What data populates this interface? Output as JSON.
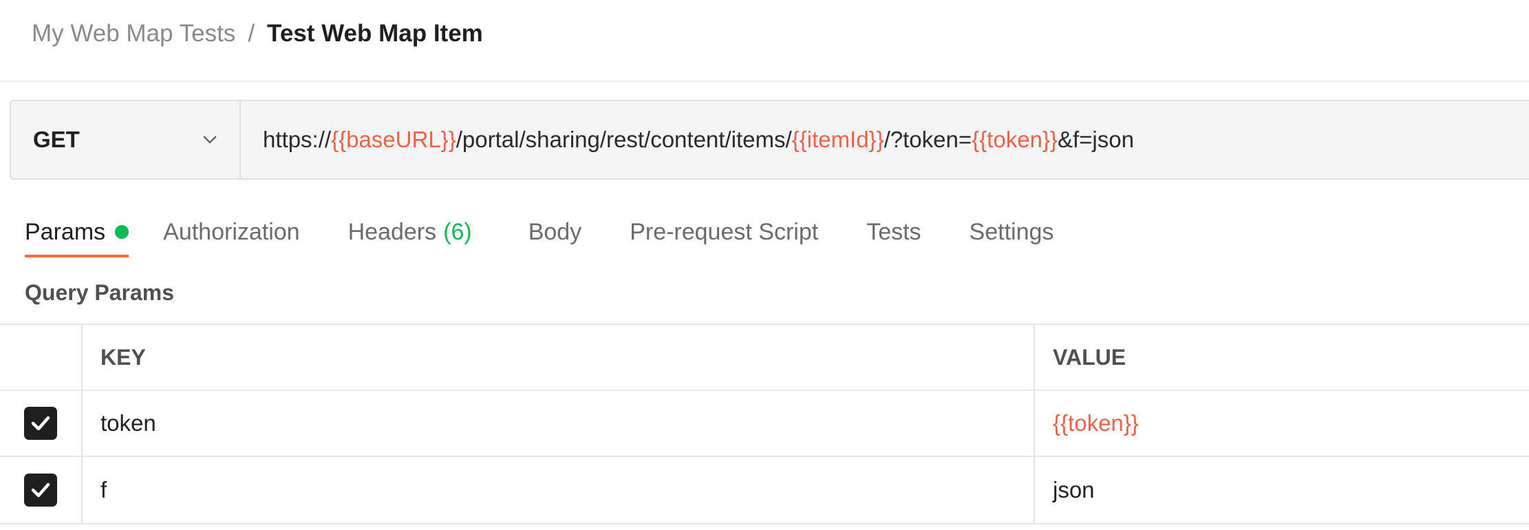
{
  "breadcrumb": {
    "parent": "My Web Map Tests",
    "separator": "/",
    "current": "Test Web Map Item"
  },
  "request": {
    "method": "GET",
    "url_parts": {
      "p1": "https://",
      "v1": "{{baseURL}}",
      "p2": "/portal/sharing/rest/content/items/",
      "v2": "{{itemId}}",
      "p3": "/?token=",
      "v3": "{{token}}",
      "p4": "&f=json"
    }
  },
  "tabs": {
    "params": "Params",
    "authorization": "Authorization",
    "headers": "Headers",
    "headers_count": "(6)",
    "body": "Body",
    "prerequest": "Pre-request Script",
    "tests": "Tests",
    "settings": "Settings"
  },
  "query_params": {
    "title": "Query Params",
    "columns": {
      "key": "KEY",
      "value": "VALUE"
    },
    "rows": [
      {
        "checked": true,
        "key": "token",
        "value": "{{token}}"
      },
      {
        "checked": true,
        "key": "f",
        "value": "json"
      }
    ]
  },
  "colors": {
    "accent": "#ff6c37",
    "variable": "#ef6149",
    "success": "#0cbb52"
  }
}
